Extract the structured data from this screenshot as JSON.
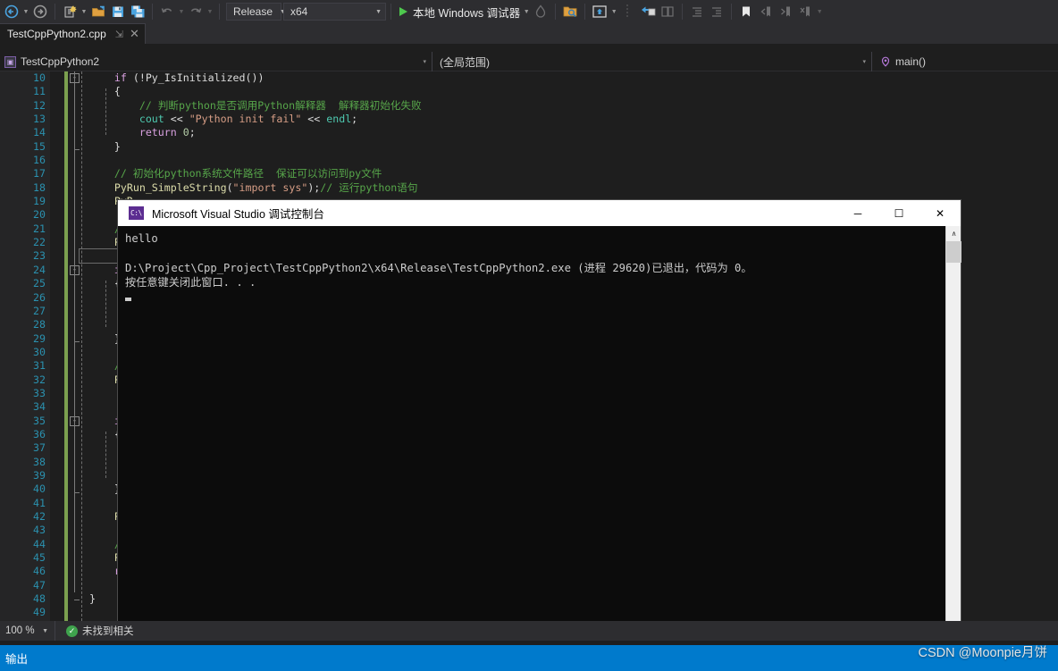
{
  "toolbar": {
    "nav_back": "navigate-back",
    "nav_forward": "navigate-forward",
    "new_project": "new-project",
    "open_file": "open-file",
    "save": "save",
    "save_all": "save-all",
    "undo": "undo",
    "redo": "redo",
    "configuration": "Release",
    "platform": "x64",
    "run_label": "本地 Windows 调试器",
    "hot_reload": "hot-reload",
    "solution_explorer": "solution-explorer-search",
    "preview": "preview-selected-items",
    "properties": "properties-window",
    "toolbox": "toolbox",
    "indent_dec": "decrease-indent",
    "indent_inc": "increase-indent",
    "bookmark": "toggle-bookmark",
    "bookmark_prev": "previous-bookmark",
    "bookmark_next": "next-bookmark",
    "bookmark_clear": "clear-bookmarks",
    "overflow": "toolbar-overflow"
  },
  "tab": {
    "title": "TestCppPython2.cpp",
    "pin_glyph": "⇲",
    "close_glyph": "✕"
  },
  "navbar": {
    "project": "TestCppPython2",
    "scope": "(全局范围)",
    "member": "main()",
    "arrow_glyph": "▾"
  },
  "editor": {
    "zoom": "100 %",
    "status_message": "未找到相关",
    "lines": [
      {
        "n": "10",
        "fold": "-",
        "segs": [
          {
            "t": "    ",
            "c": "pln"
          },
          {
            "t": "if",
            "c": "kw"
          },
          {
            "t": " (!Py_IsInitialized())",
            "c": "pln"
          }
        ]
      },
      {
        "n": "11",
        "segs": [
          {
            "t": "    {",
            "c": "pln"
          }
        ]
      },
      {
        "n": "12",
        "segs": [
          {
            "t": "        ",
            "c": "pln"
          },
          {
            "t": "// 判断python是否调用Python解释器  解释器初始化失败",
            "c": "cmt"
          }
        ]
      },
      {
        "n": "13",
        "segs": [
          {
            "t": "        ",
            "c": "pln"
          },
          {
            "t": "cout",
            "c": "typ"
          },
          {
            "t": " << ",
            "c": "pln"
          },
          {
            "t": "\"Python init fail\"",
            "c": "str"
          },
          {
            "t": " << ",
            "c": "pln"
          },
          {
            "t": "endl",
            "c": "typ"
          },
          {
            "t": ";",
            "c": "pln"
          }
        ]
      },
      {
        "n": "14",
        "segs": [
          {
            "t": "        ",
            "c": "pln"
          },
          {
            "t": "return",
            "c": "kw"
          },
          {
            "t": " ",
            "c": "pln"
          },
          {
            "t": "0",
            "c": "num"
          },
          {
            "t": ";",
            "c": "pln"
          }
        ]
      },
      {
        "n": "15",
        "segs": [
          {
            "t": "    }",
            "c": "pln"
          }
        ]
      },
      {
        "n": "16",
        "segs": [
          {
            "t": "",
            "c": "pln"
          }
        ]
      },
      {
        "n": "17",
        "segs": [
          {
            "t": "    ",
            "c": "pln"
          },
          {
            "t": "// 初始化python系统文件路径  保证可以访问到py文件",
            "c": "cmt"
          }
        ]
      },
      {
        "n": "18",
        "segs": [
          {
            "t": "    ",
            "c": "pln"
          },
          {
            "t": "PyRun_SimpleString",
            "c": "fn"
          },
          {
            "t": "(",
            "c": "pln"
          },
          {
            "t": "\"import sys\"",
            "c": "str"
          },
          {
            "t": ");",
            "c": "pln"
          },
          {
            "t": "// 运行python语句",
            "c": "cmt"
          }
        ]
      },
      {
        "n": "19",
        "segs": [
          {
            "t": "    ",
            "c": "pln"
          },
          {
            "t": "PyR",
            "c": "fn"
          }
        ]
      },
      {
        "n": "20",
        "segs": [
          {
            "t": "",
            "c": "pln"
          }
        ]
      },
      {
        "n": "21",
        "segs": [
          {
            "t": "    ",
            "c": "pln"
          },
          {
            "t": "//",
            "c": "cmt"
          }
        ]
      },
      {
        "n": "22",
        "segs": [
          {
            "t": "    ",
            "c": "pln"
          },
          {
            "t": "PyO",
            "c": "fn"
          }
        ]
      },
      {
        "n": "23",
        "cursor": true,
        "segs": [
          {
            "t": "",
            "c": "pln"
          }
        ]
      },
      {
        "n": "24",
        "fold": "-",
        "segs": [
          {
            "t": "    ",
            "c": "pln"
          },
          {
            "t": "if",
            "c": "kw"
          }
        ]
      },
      {
        "n": "25",
        "segs": [
          {
            "t": "    {",
            "c": "pln"
          }
        ]
      },
      {
        "n": "26",
        "segs": [
          {
            "t": "",
            "c": "pln"
          }
        ]
      },
      {
        "n": "27",
        "segs": [
          {
            "t": "",
            "c": "pln"
          }
        ]
      },
      {
        "n": "28",
        "segs": [
          {
            "t": "",
            "c": "pln"
          }
        ]
      },
      {
        "n": "29",
        "segs": [
          {
            "t": "    }",
            "c": "pln"
          }
        ]
      },
      {
        "n": "30",
        "segs": [
          {
            "t": "",
            "c": "pln"
          }
        ]
      },
      {
        "n": "31",
        "segs": [
          {
            "t": "    ",
            "c": "pln"
          },
          {
            "t": "//",
            "c": "cmt"
          }
        ]
      },
      {
        "n": "32",
        "segs": [
          {
            "t": "    ",
            "c": "pln"
          },
          {
            "t": "PyO",
            "c": "fn"
          }
        ]
      },
      {
        "n": "33",
        "segs": [
          {
            "t": "",
            "c": "pln"
          }
        ]
      },
      {
        "n": "34",
        "segs": [
          {
            "t": "",
            "c": "pln"
          }
        ]
      },
      {
        "n": "35",
        "fold": "-",
        "segs": [
          {
            "t": "    ",
            "c": "pln"
          },
          {
            "t": "if",
            "c": "kw"
          }
        ]
      },
      {
        "n": "36",
        "segs": [
          {
            "t": "    {",
            "c": "pln"
          }
        ]
      },
      {
        "n": "37",
        "segs": [
          {
            "t": "",
            "c": "pln"
          }
        ]
      },
      {
        "n": "38",
        "segs": [
          {
            "t": "",
            "c": "pln"
          }
        ]
      },
      {
        "n": "39",
        "segs": [
          {
            "t": "",
            "c": "pln"
          }
        ]
      },
      {
        "n": "40",
        "segs": [
          {
            "t": "    }",
            "c": "pln"
          }
        ]
      },
      {
        "n": "41",
        "segs": [
          {
            "t": "",
            "c": "pln"
          }
        ]
      },
      {
        "n": "42",
        "segs": [
          {
            "t": "    ",
            "c": "pln"
          },
          {
            "t": "PyO",
            "c": "fn"
          }
        ]
      },
      {
        "n": "43",
        "segs": [
          {
            "t": "",
            "c": "pln"
          }
        ]
      },
      {
        "n": "44",
        "segs": [
          {
            "t": "    ",
            "c": "pln"
          },
          {
            "t": "//",
            "c": "cmt"
          }
        ]
      },
      {
        "n": "45",
        "segs": [
          {
            "t": "    ",
            "c": "pln"
          },
          {
            "t": "Py_",
            "c": "fn"
          }
        ]
      },
      {
        "n": "46",
        "segs": [
          {
            "t": "    ",
            "c": "pln"
          },
          {
            "t": "ret",
            "c": "kw"
          }
        ]
      },
      {
        "n": "47",
        "segs": [
          {
            "t": "",
            "c": "pln"
          }
        ]
      },
      {
        "n": "48",
        "segs": [
          {
            "t": "}",
            "c": "pln"
          }
        ]
      },
      {
        "n": "49",
        "segs": [
          {
            "t": "",
            "c": "pln"
          }
        ]
      }
    ]
  },
  "console": {
    "title": "Microsoft Visual Studio 调试控制台",
    "icon_text": "C:\\",
    "minimize_glyph": "─",
    "maximize_glyph": "☐",
    "close_glyph": "✕",
    "lines": [
      "hello",
      "",
      "D:\\Project\\Cpp_Project\\TestCppPython2\\x64\\Release\\TestCppPython2.exe (进程 29620)已退出，代码为 0。",
      "按任意键关闭此窗口. . ."
    ],
    "scroll_up_glyph": "∧",
    "scroll_down_glyph": "∨"
  },
  "bottom": {
    "panel_label": "输出",
    "watermark": "CSDN @Moonpie月饼"
  },
  "colors": {
    "accent": "#007acc",
    "chrome": "#2d2d30",
    "editor_bg": "#1e1e1e",
    "console_bg": "#0c0c0c",
    "linenum": "#2b91af",
    "comment": "#57a64a",
    "string": "#d69d85",
    "keyword": "#d8a0df",
    "function": "#dcdcaa",
    "changebar": "#7ba04f"
  }
}
